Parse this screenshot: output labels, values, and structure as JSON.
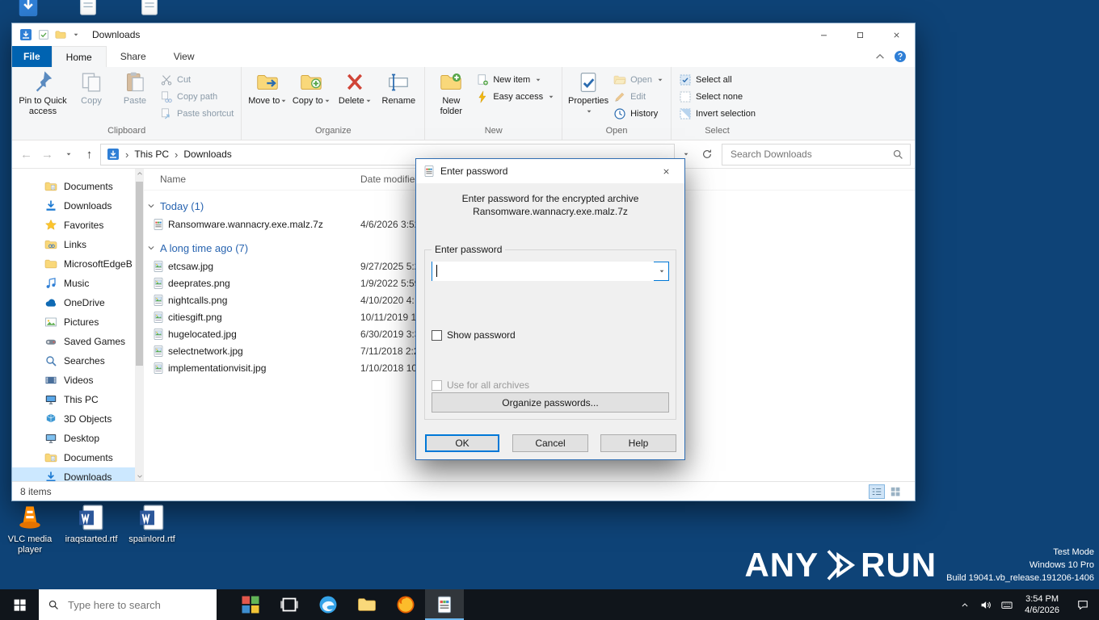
{
  "colors": {
    "accent": "#0078d7",
    "desktop_background": "#0e4377",
    "file_tab": "#0063b1",
    "taskbar": "#10151b"
  },
  "desktop": {
    "icons": [
      {
        "label": "VLC media player",
        "icon": "vlc"
      },
      {
        "label": "iraqstarted.rtf",
        "icon": "word"
      },
      {
        "label": "spainlord.rtf",
        "icon": "word"
      }
    ]
  },
  "explorer": {
    "window_title": "Downloads",
    "tabs": {
      "file": "File",
      "home": "Home",
      "share": "Share",
      "view": "View"
    },
    "ribbon": {
      "clipboard": {
        "label": "Clipboard",
        "pin": "Pin to Quick access",
        "copy": "Copy",
        "paste": "Paste",
        "cut": "Cut",
        "copy_path": "Copy path",
        "paste_shortcut": "Paste shortcut"
      },
      "organize": {
        "label": "Organize",
        "move_to": "Move to",
        "copy_to": "Copy to",
        "delete": "Delete",
        "rename": "Rename"
      },
      "new_group": {
        "label": "New",
        "new_folder": "New folder",
        "new_item": "New item",
        "easy_access": "Easy access"
      },
      "open_group": {
        "label": "Open",
        "properties": "Properties",
        "open": "Open",
        "edit": "Edit",
        "history": "History"
      },
      "select_group": {
        "label": "Select",
        "select_all": "Select all",
        "select_none": "Select none",
        "invert_selection": "Invert selection"
      }
    },
    "address": {
      "crumb_root": "This PC",
      "crumb_current": "Downloads",
      "search_placeholder": "Search Downloads"
    },
    "sidebar": [
      {
        "label": "Documents",
        "icon": "folderdoc"
      },
      {
        "label": "Downloads",
        "icon": "download"
      },
      {
        "label": "Favorites",
        "icon": "star"
      },
      {
        "label": "Links",
        "icon": "folderlink"
      },
      {
        "label": "MicrosoftEdgeB",
        "icon": "folder"
      },
      {
        "label": "Music",
        "icon": "music"
      },
      {
        "label": "OneDrive",
        "icon": "cloud"
      },
      {
        "label": "Pictures",
        "icon": "picture"
      },
      {
        "label": "Saved Games",
        "icon": "game"
      },
      {
        "label": "Searches",
        "icon": "searchside"
      },
      {
        "label": "Videos",
        "icon": "video"
      },
      {
        "label": "This PC",
        "icon": "pc"
      },
      {
        "label": "3D Objects",
        "icon": "cube"
      },
      {
        "label": "Desktop",
        "icon": "monitor"
      },
      {
        "label": "Documents",
        "icon": "folderdoc"
      },
      {
        "label": "Downloads",
        "icon": "download",
        "selected": true
      }
    ],
    "columns": {
      "name": "Name",
      "date": "Date modified"
    },
    "file_groups": [
      {
        "name": "Today (1)",
        "items": [
          {
            "name": "Ransomware.wannacry.exe.malz.7z",
            "date": "4/6/2026 3:52",
            "icon": "archive"
          }
        ]
      },
      {
        "name": "A long time ago (7)",
        "items": [
          {
            "name": "etcsaw.jpg",
            "date": "9/27/2025 5:2",
            "icon": "imgfile"
          },
          {
            "name": "deeprates.png",
            "date": "1/9/2022 5:59",
            "icon": "imgfile"
          },
          {
            "name": "nightcalls.png",
            "date": "4/10/2020 4:",
            "icon": "imgfile"
          },
          {
            "name": "citiesgift.png",
            "date": "10/11/2019 1",
            "icon": "imgfile"
          },
          {
            "name": "hugelocated.jpg",
            "date": "6/30/2019 3:3",
            "icon": "imgfile"
          },
          {
            "name": "selectnetwork.jpg",
            "date": "7/11/2018 2:2",
            "icon": "imgfile"
          },
          {
            "name": "implementationvisit.jpg",
            "date": "1/10/2018 10",
            "icon": "imgfile"
          }
        ]
      }
    ],
    "status": "8 items"
  },
  "dialog": {
    "title": "Enter password",
    "message_line1": "Enter password for the encrypted archive",
    "message_line2": "Ransomware.wannacry.exe.malz.7z",
    "group_label": "Enter password",
    "password_value": "",
    "show_password_label": "Show password",
    "use_all_label": "Use for all archives",
    "organize_label": "Organize passwords...",
    "ok_label": "OK",
    "cancel_label": "Cancel",
    "help_label": "Help"
  },
  "watermark": {
    "brand_left": "ANY",
    "brand_right": "RUN",
    "mode": "Test Mode",
    "os": "Windows 10 Pro",
    "build": "Build 19041.vb_release.191206-1406"
  },
  "taskbar": {
    "search_placeholder": "Type here to search",
    "time": "3:54 PM",
    "date": "4/6/2026"
  }
}
